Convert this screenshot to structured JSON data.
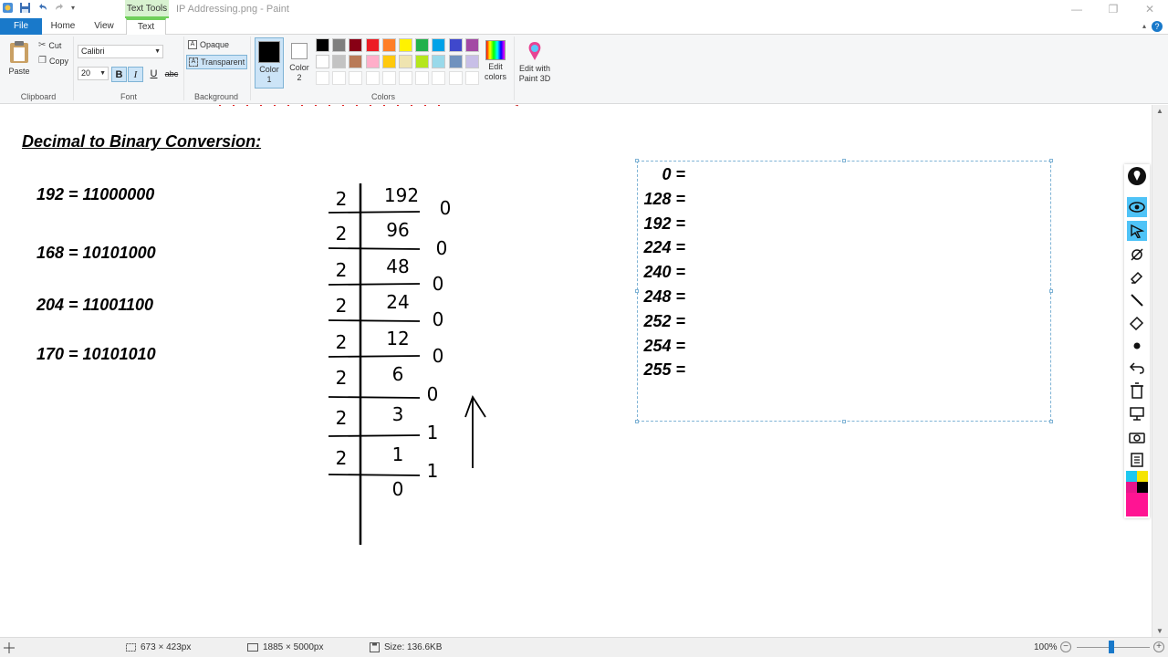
{
  "window": {
    "title": "IP Addressing.png - Paint",
    "context_tab": "Text Tools"
  },
  "menu": {
    "file": "File",
    "home": "Home",
    "view": "View",
    "text": "Text"
  },
  "ribbon": {
    "clipboard": {
      "label": "Clipboard",
      "paste": "Paste",
      "cut": "Cut",
      "copy": "Copy"
    },
    "font": {
      "label": "Font",
      "family": "Calibri",
      "size": "20",
      "bold": "B",
      "italic": "I",
      "underline": "U",
      "strike": "abc"
    },
    "background": {
      "label": "Background",
      "opaque": "Opaque",
      "transparent": "Transparent"
    },
    "colors": {
      "label": "Colors",
      "color1": "Color 1",
      "color2": "Color 2",
      "edit_colors": "Edit colors",
      "paint3d": "Edit with Paint 3D",
      "color1_value": "#000000",
      "color2_value": "#ffffff",
      "palette_row1": [
        "#000000",
        "#7f7f7f",
        "#880015",
        "#ed1c24",
        "#ff7f27",
        "#fff200",
        "#22b14c",
        "#00a2e8",
        "#3f48cc",
        "#a349a4"
      ],
      "palette_row2": [
        "#ffffff",
        "#c3c3c3",
        "#b97a57",
        "#ffaec9",
        "#ffc90e",
        "#efe4b0",
        "#b5e61d",
        "#99d9ea",
        "#7092be",
        "#c8bfe7"
      ]
    }
  },
  "canvas": {
    "heading": "Decimal to Binary Conversion:",
    "conversions": [
      "192 = 11000000",
      "168 = 10101000",
      "204 = 11001100",
      "170 = 10101010"
    ],
    "division": {
      "divisor": "2",
      "quotients": [
        "192",
        "96",
        "48",
        "24",
        "12",
        "6",
        "3",
        "1",
        "0"
      ],
      "remainders": [
        "0",
        "0",
        "0",
        "0",
        "0",
        "0",
        "1",
        "1"
      ]
    },
    "textbox_values": [
      "0 =",
      "128 =",
      "192 =",
      "224 =",
      "240 =",
      "248 =",
      "252 =",
      "254 =",
      "255 ="
    ]
  },
  "status": {
    "cursor": "673 × 423px",
    "canvas_size": "1885 × 5000px",
    "file_size": "Size: 136.6KB",
    "zoom": "100%"
  }
}
